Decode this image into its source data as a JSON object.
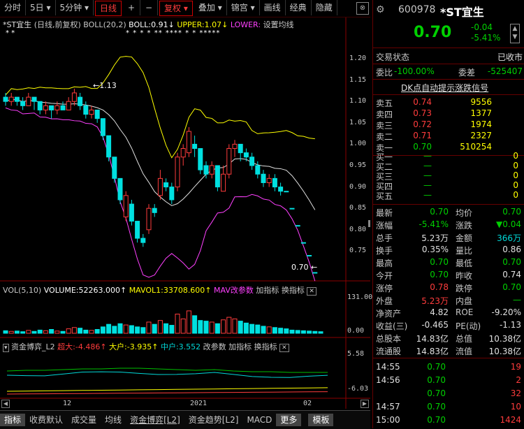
{
  "toolbar": {
    "items": [
      "分时",
      "5日",
      "5分钟",
      "日线",
      "+",
      "−",
      "复权",
      "叠加",
      "锦宫",
      "画线",
      "经典",
      "隐藏"
    ],
    "close": "⊗"
  },
  "main_chart": {
    "title": "*ST宜生",
    "subtitle": "(日线,前复权)",
    "boll": "BOLL(20,2)",
    "boll_val": "BOLL:0.91",
    "upper": "UPPER:1.07",
    "lower": "LOWER:",
    "set_ma": "设置均线",
    "high_label": "1.13",
    "last_label": "0.70",
    "y_ticks": [
      "1.20",
      "1.15",
      "1.10",
      "1.05",
      "1.00",
      "0.95",
      "0.90",
      "0.85",
      "0.80",
      "0.75"
    ],
    "stars_left": "*   *",
    "stars_right": "* *  * *  **  ****  * *  *****",
    "candles": [
      {
        "o": 1.11,
        "c": 1.1,
        "h": 1.12,
        "l": 1.09
      },
      {
        "o": 1.1,
        "c": 1.11,
        "h": 1.12,
        "l": 1.09
      },
      {
        "o": 1.11,
        "c": 1.1,
        "h": 1.11,
        "l": 1.09
      },
      {
        "o": 1.1,
        "c": 1.09,
        "h": 1.11,
        "l": 1.08
      },
      {
        "o": 1.09,
        "c": 1.11,
        "h": 1.12,
        "l": 1.09
      },
      {
        "o": 1.11,
        "c": 1.1,
        "h": 1.11,
        "l": 1.08
      },
      {
        "o": 1.1,
        "c": 1.08,
        "h": 1.1,
        "l": 1.07
      },
      {
        "o": 1.08,
        "c": 1.09,
        "h": 1.1,
        "l": 1.07
      },
      {
        "o": 1.09,
        "c": 1.08,
        "h": 1.09,
        "l": 1.06
      },
      {
        "o": 1.08,
        "c": 1.09,
        "h": 1.1,
        "l": 1.07
      },
      {
        "o": 1.09,
        "c": 1.08,
        "h": 1.1,
        "l": 1.08
      },
      {
        "o": 1.08,
        "c": 1.1,
        "h": 1.11,
        "l": 1.08
      },
      {
        "o": 1.1,
        "c": 1.12,
        "h": 1.13,
        "l": 1.09
      },
      {
        "o": 1.11,
        "c": 1.09,
        "h": 1.12,
        "l": 1.08
      },
      {
        "o": 1.09,
        "c": 1.07,
        "h": 1.1,
        "l": 1.06
      },
      {
        "o": 1.07,
        "c": 1.08,
        "h": 1.09,
        "l": 1.06
      },
      {
        "o": 1.08,
        "c": 1.06,
        "h": 1.08,
        "l": 1.05
      },
      {
        "o": 1.06,
        "c": 1.02,
        "h": 1.06,
        "l": 1.01
      },
      {
        "o": 1.02,
        "c": 0.97,
        "h": 1.02,
        "l": 0.96
      },
      {
        "o": 0.97,
        "c": 0.92,
        "h": 0.97,
        "l": 0.91
      },
      {
        "o": 0.92,
        "c": 0.87,
        "h": 0.92,
        "l": 0.86
      },
      {
        "o": 0.83,
        "c": 0.88,
        "h": 0.89,
        "l": 0.82
      },
      {
        "o": 0.86,
        "c": 0.82,
        "h": 0.87,
        "l": 0.81
      },
      {
        "o": 0.82,
        "c": 0.78,
        "h": 0.82,
        "l": 0.77
      },
      {
        "o": 0.78,
        "c": 0.77,
        "h": 0.79,
        "l": 0.76
      },
      {
        "o": 0.8,
        "c": 0.85,
        "h": 0.86,
        "l": 0.79
      },
      {
        "o": 0.85,
        "c": 0.84,
        "h": 0.86,
        "l": 0.83
      },
      {
        "o": 0.88,
        "c": 0.92,
        "h": 0.94,
        "l": 0.87
      },
      {
        "o": 0.91,
        "c": 0.9,
        "h": 0.92,
        "l": 0.89
      },
      {
        "o": 0.9,
        "c": 0.87,
        "h": 0.91,
        "l": 0.86
      },
      {
        "o": 0.9,
        "c": 0.97,
        "h": 0.98,
        "l": 0.89
      },
      {
        "o": 0.97,
        "c": 0.99,
        "h": 1.0,
        "l": 0.95
      },
      {
        "o": 0.98,
        "c": 1.03,
        "h": 1.04,
        "l": 0.97
      },
      {
        "o": 1.0,
        "c": 0.99,
        "h": 1.02,
        "l": 0.97
      },
      {
        "o": 0.99,
        "c": 0.94,
        "h": 0.99,
        "l": 0.93
      },
      {
        "o": 0.95,
        "c": 0.93,
        "h": 0.96,
        "l": 0.92
      },
      {
        "o": 0.93,
        "c": 0.95,
        "h": 0.96,
        "l": 0.92
      },
      {
        "o": 0.95,
        "c": 0.9,
        "h": 0.95,
        "l": 0.89
      },
      {
        "o": 0.89,
        "c": 0.93,
        "h": 0.95,
        "l": 0.89
      },
      {
        "o": 0.93,
        "c": 0.99,
        "h": 1.0,
        "l": 0.92
      },
      {
        "o": 0.99,
        "c": 1.0,
        "h": 1.01,
        "l": 0.97
      },
      {
        "o": 1.0,
        "c": 0.98,
        "h": 1.0,
        "l": 0.96
      },
      {
        "o": 0.98,
        "c": 0.97,
        "h": 0.99,
        "l": 0.96
      },
      {
        "o": 0.97,
        "c": 0.95,
        "h": 0.98,
        "l": 0.94
      },
      {
        "o": 0.95,
        "c": 0.93,
        "h": 0.96,
        "l": 0.92
      },
      {
        "o": 0.93,
        "c": 0.91,
        "h": 0.94,
        "l": 0.9
      },
      {
        "o": 0.91,
        "c": 0.92,
        "h": 0.93,
        "l": 0.9
      },
      {
        "o": 0.92,
        "c": 0.9,
        "h": 0.93,
        "l": 0.89
      },
      {
        "o": 0.9,
        "c": 0.89,
        "h": 0.91,
        "l": 0.88
      },
      {
        "o": 0.89,
        "c": 0.89,
        "h": 0.89,
        "l": 0.89
      },
      {
        "o": 0.85,
        "c": 0.85,
        "h": 0.85,
        "l": 0.85
      },
      {
        "o": 0.81,
        "c": 0.81,
        "h": 0.81,
        "l": 0.81
      },
      {
        "o": 0.77,
        "c": 0.77,
        "h": 0.77,
        "l": 0.77
      },
      {
        "o": 0.74,
        "c": 0.74,
        "h": 0.74,
        "l": 0.74
      },
      {
        "o": 0.7,
        "c": 0.7,
        "h": 0.7,
        "l": 0.7
      }
    ]
  },
  "vol_chart": {
    "label": "VOL(5,10)",
    "volume": "VOLUME:52263.000",
    "mavol1": "MAVOL1:33708.600",
    "mav": "MAV改参数",
    "add": "加指标",
    "swap": "换指标",
    "y_top": "131.00",
    "y_mid": "0.00",
    "bars": [
      8,
      6,
      7,
      5,
      9,
      6,
      10,
      8,
      12,
      7,
      6,
      14,
      18,
      16,
      10,
      9,
      12,
      20,
      28,
      22,
      30,
      26,
      24,
      20,
      18,
      35,
      28,
      40,
      30,
      25,
      60,
      45,
      70,
      55,
      40,
      38,
      35,
      30,
      42,
      50,
      45,
      38,
      32,
      28,
      26,
      22,
      20,
      18,
      16,
      14,
      10,
      9,
      8,
      7,
      6,
      5
    ]
  },
  "fund_chart": {
    "label": "资金博弈_L2",
    "super": "超大:-4.486",
    "big": "大户:-3.935",
    "mid": "中户:3.552",
    "param": "改参数",
    "add": "加指标",
    "swap": "换指标",
    "y_top": "5.58",
    "y_bot": "-6.03"
  },
  "x_axis": {
    "m12": "12",
    "y2021": "2021",
    "m02": "02"
  },
  "bottom_tabs": [
    "指标",
    "收费默认",
    "成交量",
    "均线",
    "资金博弈[L2]",
    "资金趋势[L2]",
    "MACD",
    "更多",
    "模板"
  ],
  "quote": {
    "code": "600978",
    "name": "*ST宜生",
    "price": "0.70",
    "change": "-0.04",
    "pct": "-5.41%",
    "status_label": "交易状态",
    "status": "已收市",
    "wb_label": "委比",
    "wb": "-100.00%",
    "wc_label": "委差",
    "wc": "-525407",
    "signal": "DK点自动提示涨跌信号",
    "asks": [
      {
        "l": "卖五",
        "p": "0.74",
        "v": "9556"
      },
      {
        "l": "卖四",
        "p": "0.73",
        "v": "1377"
      },
      {
        "l": "卖三",
        "p": "0.72",
        "v": "1974"
      },
      {
        "l": "卖二",
        "p": "0.71",
        "v": "2327"
      },
      {
        "l": "卖一",
        "p": "0.70",
        "v": "510254"
      }
    ],
    "bids": [
      {
        "l": "买一",
        "p": "—",
        "v": "0"
      },
      {
        "l": "买二",
        "p": "—",
        "v": "0"
      },
      {
        "l": "买三",
        "p": "—",
        "v": "0"
      },
      {
        "l": "买四",
        "p": "—",
        "v": "0"
      },
      {
        "l": "买五",
        "p": "—",
        "v": "0"
      }
    ],
    "stats": [
      {
        "l1": "最新",
        "v1": "0.70",
        "c1": "green",
        "l2": "均价",
        "v2": "0.70",
        "c2": "green"
      },
      {
        "l1": "涨幅",
        "v1": "-5.41%",
        "c1": "green",
        "l2": "涨跌",
        "v2": "▼0.04",
        "c2": "green"
      },
      {
        "l1": "总手",
        "v1": "5.23万",
        "c1": "white",
        "l2": "金额",
        "v2": "366万",
        "c2": "cyan"
      },
      {
        "l1": "换手",
        "v1": "0.35%",
        "c1": "white",
        "l2": "量比",
        "v2": "0.86",
        "c2": "white"
      },
      {
        "l1": "最高",
        "v1": "0.70",
        "c1": "green",
        "l2": "最低",
        "v2": "0.70",
        "c2": "green"
      },
      {
        "l1": "今开",
        "v1": "0.70",
        "c1": "green",
        "l2": "昨收",
        "v2": "0.74",
        "c2": "white"
      },
      {
        "l1": "涨停",
        "v1": "0.78",
        "c1": "red",
        "l2": "跌停",
        "v2": "0.70",
        "c2": "green"
      },
      {
        "l1": "外盘",
        "v1": "5.23万",
        "c1": "red",
        "l2": "内盘",
        "v2": "—",
        "c2": "green"
      },
      {
        "l1": "净资产",
        "v1": "4.82",
        "c1": "white",
        "l2": "ROE",
        "v2": "-9.20%",
        "c2": "white"
      },
      {
        "l1": "收益(三)",
        "v1": "-0.465",
        "c1": "white",
        "l2": "PE(动)",
        "v2": "-1.13",
        "c2": "white"
      },
      {
        "l1": "总股本",
        "v1": "14.83亿",
        "c1": "white",
        "l2": "总值",
        "v2": "10.38亿",
        "c2": "white"
      },
      {
        "l1": "流通股",
        "v1": "14.83亿",
        "c1": "white",
        "l2": "流值",
        "v2": "10.38亿",
        "c2": "white"
      }
    ],
    "ticks": [
      {
        "t": "14:55",
        "p": "0.70",
        "v": "19"
      },
      {
        "t": "14:56",
        "p": "0.70",
        "v": "2"
      },
      {
        "t": "",
        "p": "0.70",
        "v": "32"
      },
      {
        "t": "14:57",
        "p": "0.70",
        "v": "10"
      },
      {
        "t": "15:00",
        "p": "0.70",
        "v": "1424"
      }
    ]
  }
}
